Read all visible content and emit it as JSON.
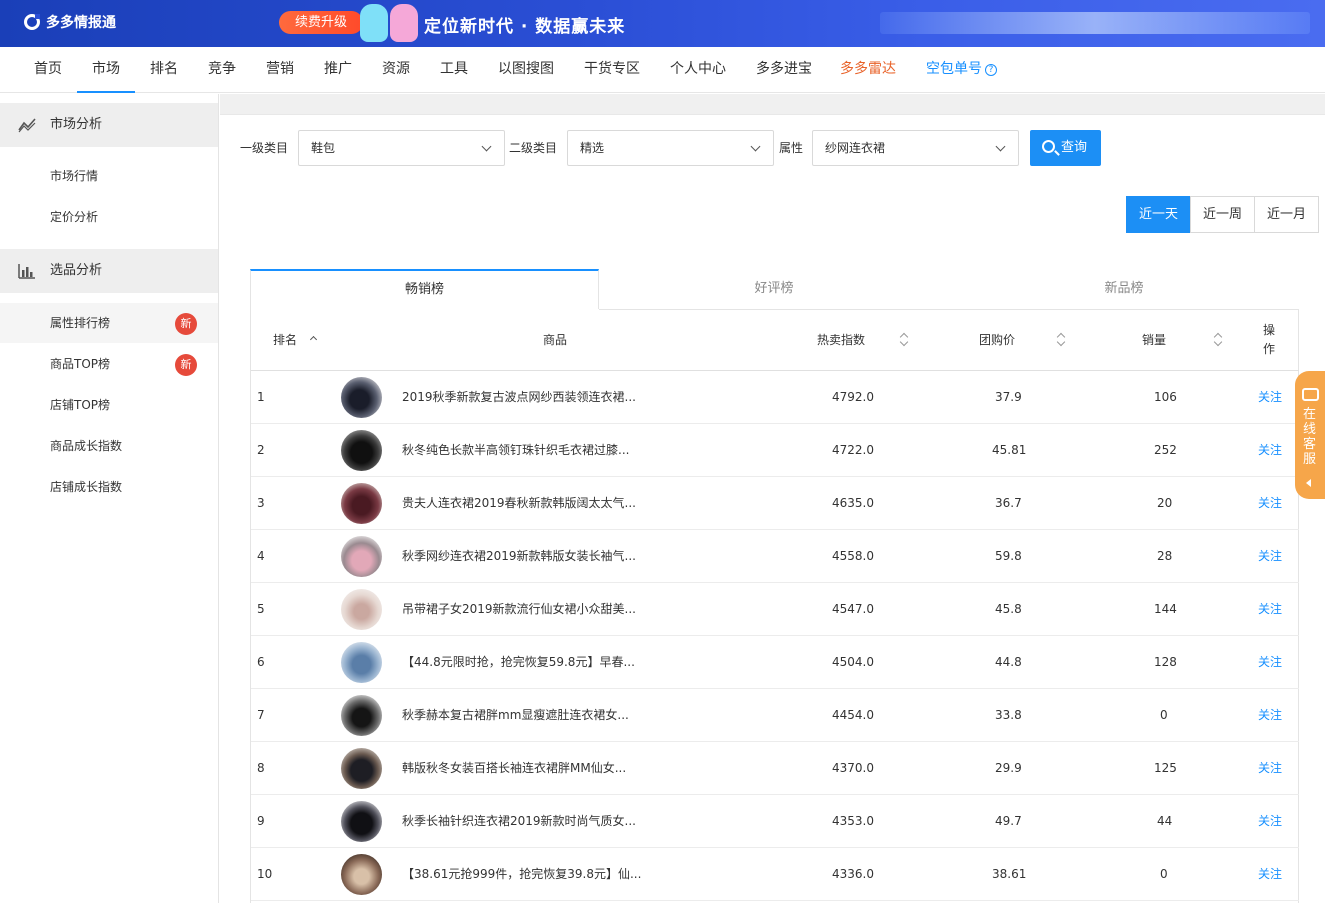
{
  "banner": {
    "logo": "多多情报通",
    "upgrade": "续费升级",
    "slogan": "定位新时代 · 数据赢未来"
  },
  "nav": [
    "首页",
    "市场",
    "排名",
    "竞争",
    "营销",
    "推广",
    "资源",
    "工具",
    "以图搜图",
    "干货专区",
    "个人中心",
    "多多进宝",
    "多多雷达",
    "空包单号"
  ],
  "nav_active": "市场",
  "sidebar": {
    "group1": {
      "title": "市场分析",
      "items": [
        "市场行情",
        "定价分析"
      ]
    },
    "group2": {
      "title": "选品分析",
      "items": [
        "属性排行榜",
        "商品TOP榜",
        "店铺TOP榜",
        "商品成长指数",
        "店铺成长指数"
      ]
    },
    "badge": "新"
  },
  "filters": {
    "level1_label": "一级类目",
    "level1_value": "鞋包",
    "level2_label": "二级类目",
    "level2_value": "精选",
    "attr_label": "属性",
    "attr_value": "纱网连衣裙",
    "query": "查询"
  },
  "periods": [
    "近一天",
    "近一周",
    "近一月"
  ],
  "tabs": [
    "畅销榜",
    "好评榜",
    "新品榜"
  ],
  "table": {
    "headers": {
      "rank": "排名",
      "product": "商品",
      "hot": "热卖指数",
      "price": "团购价",
      "sales": "销量",
      "op": "操作"
    },
    "rows": [
      {
        "rank": "1",
        "name": "2019秋季新款复古波点网纱西装领连衣裙...",
        "hot": "4792.0",
        "price": "37.9",
        "sales": "106",
        "op": "关注"
      },
      {
        "rank": "2",
        "name": "秋冬纯色长款半高领钉珠针织毛衣裙过膝...",
        "hot": "4722.0",
        "price": "45.81",
        "sales": "252",
        "op": "关注"
      },
      {
        "rank": "3",
        "name": "贵夫人连衣裙2019春秋新款韩版阔太太气...",
        "hot": "4635.0",
        "price": "36.7",
        "sales": "20",
        "op": "关注"
      },
      {
        "rank": "4",
        "name": "秋季网纱连衣裙2019新款韩版女装长袖气...",
        "hot": "4558.0",
        "price": "59.8",
        "sales": "28",
        "op": "关注"
      },
      {
        "rank": "5",
        "name": "吊带裙子女2019新款流行仙女裙小众甜美...",
        "hot": "4547.0",
        "price": "45.8",
        "sales": "144",
        "op": "关注"
      },
      {
        "rank": "6",
        "name": "【44.8元限时抢，抢完恢复59.8元】早春...",
        "hot": "4504.0",
        "price": "44.8",
        "sales": "128",
        "op": "关注"
      },
      {
        "rank": "7",
        "name": "秋季赫本复古裙胖mm显瘦遮肚连衣裙女...",
        "hot": "4454.0",
        "price": "33.8",
        "sales": "0",
        "op": "关注"
      },
      {
        "rank": "8",
        "name": "韩版秋冬女装百搭长袖连衣裙胖MM仙女...",
        "hot": "4370.0",
        "price": "29.9",
        "sales": "125",
        "op": "关注"
      },
      {
        "rank": "9",
        "name": "秋季长袖针织连衣裙2019新款时尚气质女...",
        "hot": "4353.0",
        "price": "49.7",
        "sales": "44",
        "op": "关注"
      },
      {
        "rank": "10",
        "name": "【38.61元抢999件，抢完恢复39.8元】仙...",
        "hot": "4336.0",
        "price": "38.61",
        "sales": "0",
        "op": "关注"
      }
    ]
  },
  "service": "在线客服",
  "colors": {
    "accent": "#1c8ff5",
    "badge": "#e64a3b",
    "service": "#f6a64a",
    "nav_orange": "#e8632a"
  }
}
